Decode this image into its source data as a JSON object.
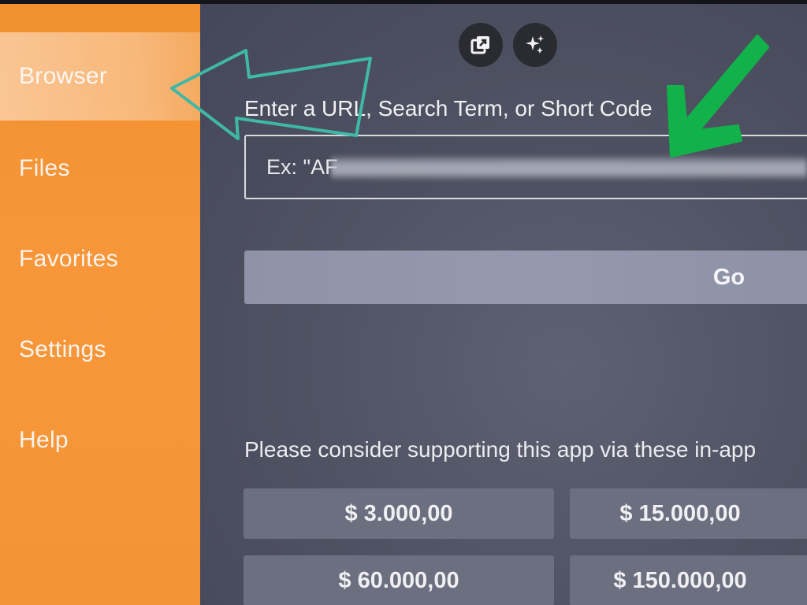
{
  "sidebar": {
    "items": [
      {
        "label": "Browser",
        "selected": true
      },
      {
        "label": "Files"
      },
      {
        "label": "Favorites"
      },
      {
        "label": "Settings"
      },
      {
        "label": "Help"
      }
    ]
  },
  "toolbar": {
    "icons": [
      "external-window-icon",
      "sparkles-icon"
    ]
  },
  "main": {
    "url_label": "Enter a URL, Search Term, or Short Code",
    "url_field_value": "Ex: \"AF",
    "go_label": "Go",
    "support_text": "Please consider supporting this app via these in-app",
    "donations": [
      "$ 3.000,00",
      "$ 15.000,00",
      "$ 60.000,00",
      "$ 150.000,00"
    ]
  },
  "annotations": {
    "arrow_teal": "pointer-arrow-to-browser",
    "arrow_green": "pointer-arrow-to-url-field"
  },
  "colors": {
    "sidebar": "#f39436",
    "main_bg": "#4e5161",
    "go_button": "#9397ac",
    "donate_button": "#6c6f80",
    "arrow_teal": "#3fb8a6",
    "arrow_green": "#12b24a"
  }
}
